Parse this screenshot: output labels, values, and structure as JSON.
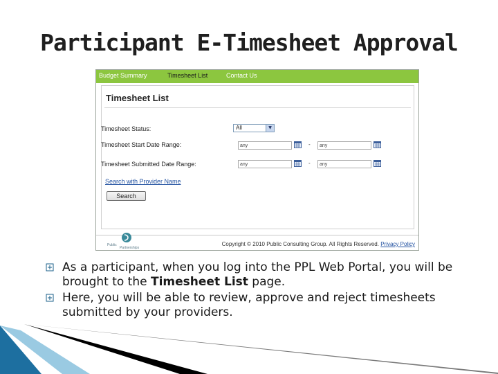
{
  "slide": {
    "title": "Participant E-Timesheet Approval"
  },
  "portal": {
    "nav": [
      "Budget Summary",
      "Timesheet List",
      "Contact Us"
    ],
    "panel_title": "Timesheet List",
    "fields": {
      "status_label": "Timesheet Status:",
      "status_value": "All",
      "start_label": "Timesheet Start Date Range:",
      "submitted_label": "Timesheet Submitted Date Range:",
      "date_placeholder": "any",
      "range_separator": "-"
    },
    "search_link": "Search with Provider Name",
    "search_button": "Search",
    "footer": {
      "copyright": "Copyright © 2010 Public Consulting Group. All Rights Reserved.",
      "privacy_link": "Privacy Policy",
      "logo_text": "Public Partnerships"
    },
    "colors": {
      "nav_bg": "#8cc63f",
      "link": "#2050a0"
    }
  },
  "bullets": [
    {
      "before": "As a participant, when you log into the PPL Web Portal, you will be brought to the ",
      "bold": "Timesheet List",
      "after": " page."
    },
    {
      "before": "Here, you will be able to review, approve and reject timesheets submitted by your providers.",
      "bold": "",
      "after": ""
    }
  ],
  "icons": {
    "bullet": "square-bullet-icon",
    "calendar": "calendar-icon",
    "dropdown": "chevron-down-icon"
  }
}
